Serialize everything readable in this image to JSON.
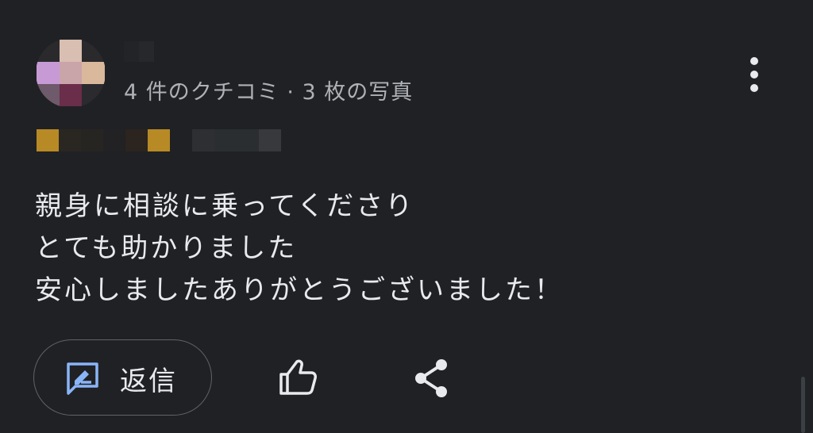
{
  "review": {
    "reviewer_meta": "4 件のクチコミ · 3 枚の写真",
    "text_lines": [
      "親身に相談に乗ってくださり",
      "とても助かりました",
      "安心しましたありがとうございました！"
    ]
  },
  "actions": {
    "reply_label": "返信"
  },
  "icons": {
    "more": "more-vert-icon",
    "reply": "reply-review-icon",
    "like": "thumb-up-icon",
    "share": "share-icon"
  },
  "colors": {
    "background": "#202124",
    "text": "#e8eaed",
    "secondary_text": "#aeb1b6",
    "outline": "#5f6368",
    "accent_blue": "#8ab4f8",
    "star_gold": "#b88a25"
  }
}
